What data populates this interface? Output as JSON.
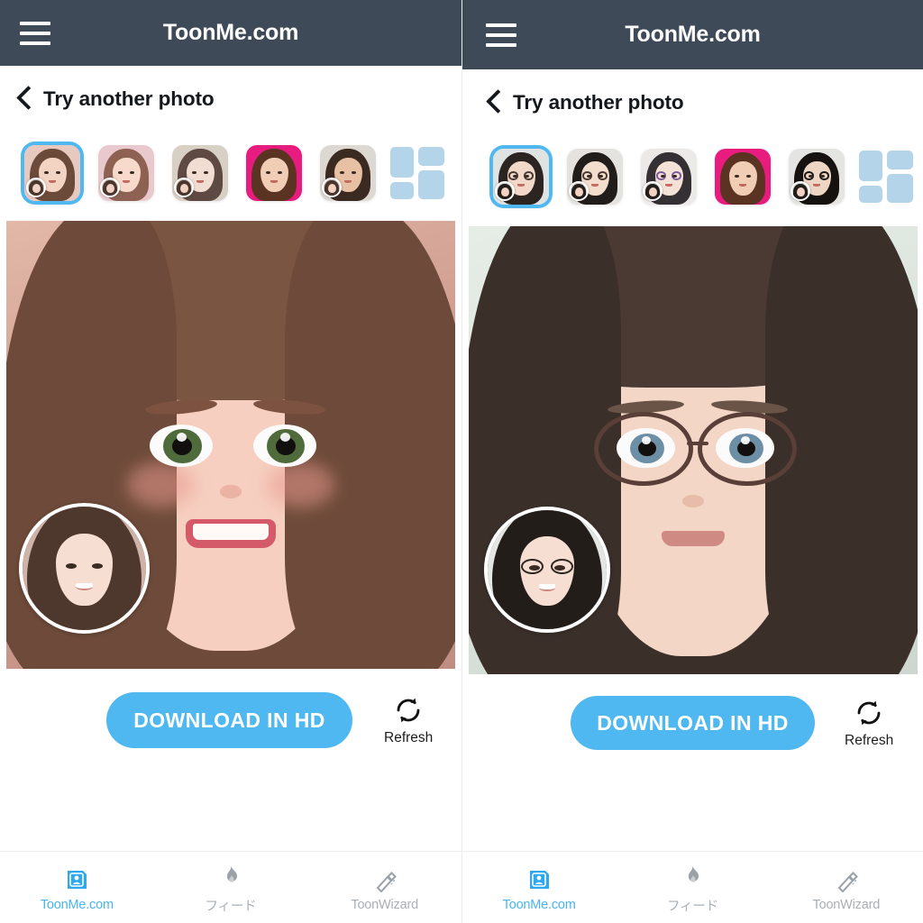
{
  "app": {
    "title": "ToonMe.com",
    "menu_icon": "hamburger-menu-icon"
  },
  "panels": [
    {
      "id": "left",
      "header": {
        "title": "ToonMe.com",
        "menu_icon": "hamburger-menu-icon"
      },
      "back": {
        "label": "Try another photo",
        "icon": "chevron-left-icon"
      },
      "styles": {
        "selected_index": 0,
        "items": [
          {
            "name": "style-thumbnail-1",
            "selected": true,
            "bg": "#e8c9bf",
            "hair": "#6b4a3a",
            "skin": "#f3d3c2",
            "glasses": false
          },
          {
            "name": "style-thumbnail-2",
            "selected": false,
            "bg": "#e9c9ce",
            "hair": "#8d6252",
            "skin": "#f7dacb",
            "glasses": false
          },
          {
            "name": "style-thumbnail-3",
            "selected": false,
            "bg": "#d8cfc5",
            "hair": "#5e4a42",
            "skin": "#f1ddd2",
            "glasses": false
          },
          {
            "name": "style-thumbnail-4",
            "selected": false,
            "bg": "#e81c7e",
            "hair": "#5b3322",
            "skin": "#f0cdb4",
            "glasses": false
          },
          {
            "name": "style-thumbnail-5",
            "selected": false,
            "bg": "#ded8d3",
            "hair": "#3b2a22",
            "skin": "#e8c0a4",
            "glasses": false
          }
        ],
        "grid_icon": {
          "name": "collage-grid-icon",
          "color": "#b4d4ea"
        }
      },
      "result": {
        "name": "toon-result-image",
        "bg": "#cf9d90",
        "hair": "#6d4a39",
        "skin": "#f6cfc0",
        "iris": "#4f6b3c",
        "glasses": false,
        "overlay_avatar": {
          "name": "original-photo-avatar",
          "bg": "#cdb3a8",
          "hair": "#4e382d"
        }
      },
      "actions": {
        "download_label": "DOWNLOAD IN HD",
        "download_color": "#4fb8f0",
        "refresh_label": "Refresh",
        "refresh_icon": "refresh-circular-arrows-icon"
      },
      "tabs": [
        {
          "label": "ToonMe.com",
          "icon": "toonme-portrait-icon",
          "active": true,
          "color": "#49b4ef"
        },
        {
          "label": "フィード",
          "icon": "flame-feed-icon",
          "active": false,
          "color": "#a9b0b6"
        },
        {
          "label": "ToonWizard",
          "icon": "magic-wand-icon",
          "active": false,
          "color": "#a9b0b6"
        }
      ]
    },
    {
      "id": "right",
      "header": {
        "title": "ToonMe.com",
        "menu_icon": "hamburger-menu-icon"
      },
      "back": {
        "label": "Try another photo",
        "icon": "chevron-left-icon"
      },
      "styles": {
        "selected_index": 0,
        "items": [
          {
            "name": "style-thumbnail-1",
            "selected": true,
            "bg": "#dfe3e2",
            "hair": "#2b2420",
            "skin": "#f2d8c9",
            "glasses": true
          },
          {
            "name": "style-thumbnail-2",
            "selected": false,
            "bg": "#e4e3df",
            "hair": "#201d1b",
            "skin": "#f3ddcc",
            "glasses": true
          },
          {
            "name": "style-thumbnail-3",
            "selected": false,
            "bg": "#eceae9",
            "hair": "#353033",
            "skin": "#f5e2d6",
            "glasses": true
          },
          {
            "name": "style-thumbnail-4",
            "selected": false,
            "bg": "#e81c7e",
            "hair": "#5b3322",
            "skin": "#f0cdb4",
            "glasses": false
          },
          {
            "name": "style-thumbnail-5",
            "selected": false,
            "bg": "#e4e4e2",
            "hair": "#15120f",
            "skin": "#eed6c4",
            "glasses": true
          }
        ],
        "grid_icon": {
          "name": "collage-grid-icon",
          "color": "#b4d4ea"
        }
      },
      "result": {
        "name": "toon-result-image",
        "bg": "#dce4de",
        "hair": "#3b2f2a",
        "skin": "#f3d6c6",
        "iris": "#6d8fa6",
        "glasses": true,
        "overlay_avatar": {
          "name": "original-photo-avatar",
          "bg": "#e4e6e3",
          "hair": "#231d1a"
        }
      },
      "actions": {
        "download_label": "DOWNLOAD IN HD",
        "download_color": "#4fb8f0",
        "refresh_label": "Refresh",
        "refresh_icon": "refresh-circular-arrows-icon"
      },
      "tabs": [
        {
          "label": "ToonMe.com",
          "icon": "toonme-portrait-icon",
          "active": true,
          "color": "#49b4ef"
        },
        {
          "label": "フィード",
          "icon": "flame-feed-icon",
          "active": false,
          "color": "#a9b0b6"
        },
        {
          "label": "ToonWizard",
          "icon": "magic-wand-icon",
          "active": false,
          "color": "#a9b0b6"
        }
      ]
    }
  ],
  "theme": {
    "appbar_bg": "#3f4a58",
    "accent": "#4fb8f0",
    "text_dark": "#14171c",
    "tab_inactive": "#a9b0b6"
  }
}
